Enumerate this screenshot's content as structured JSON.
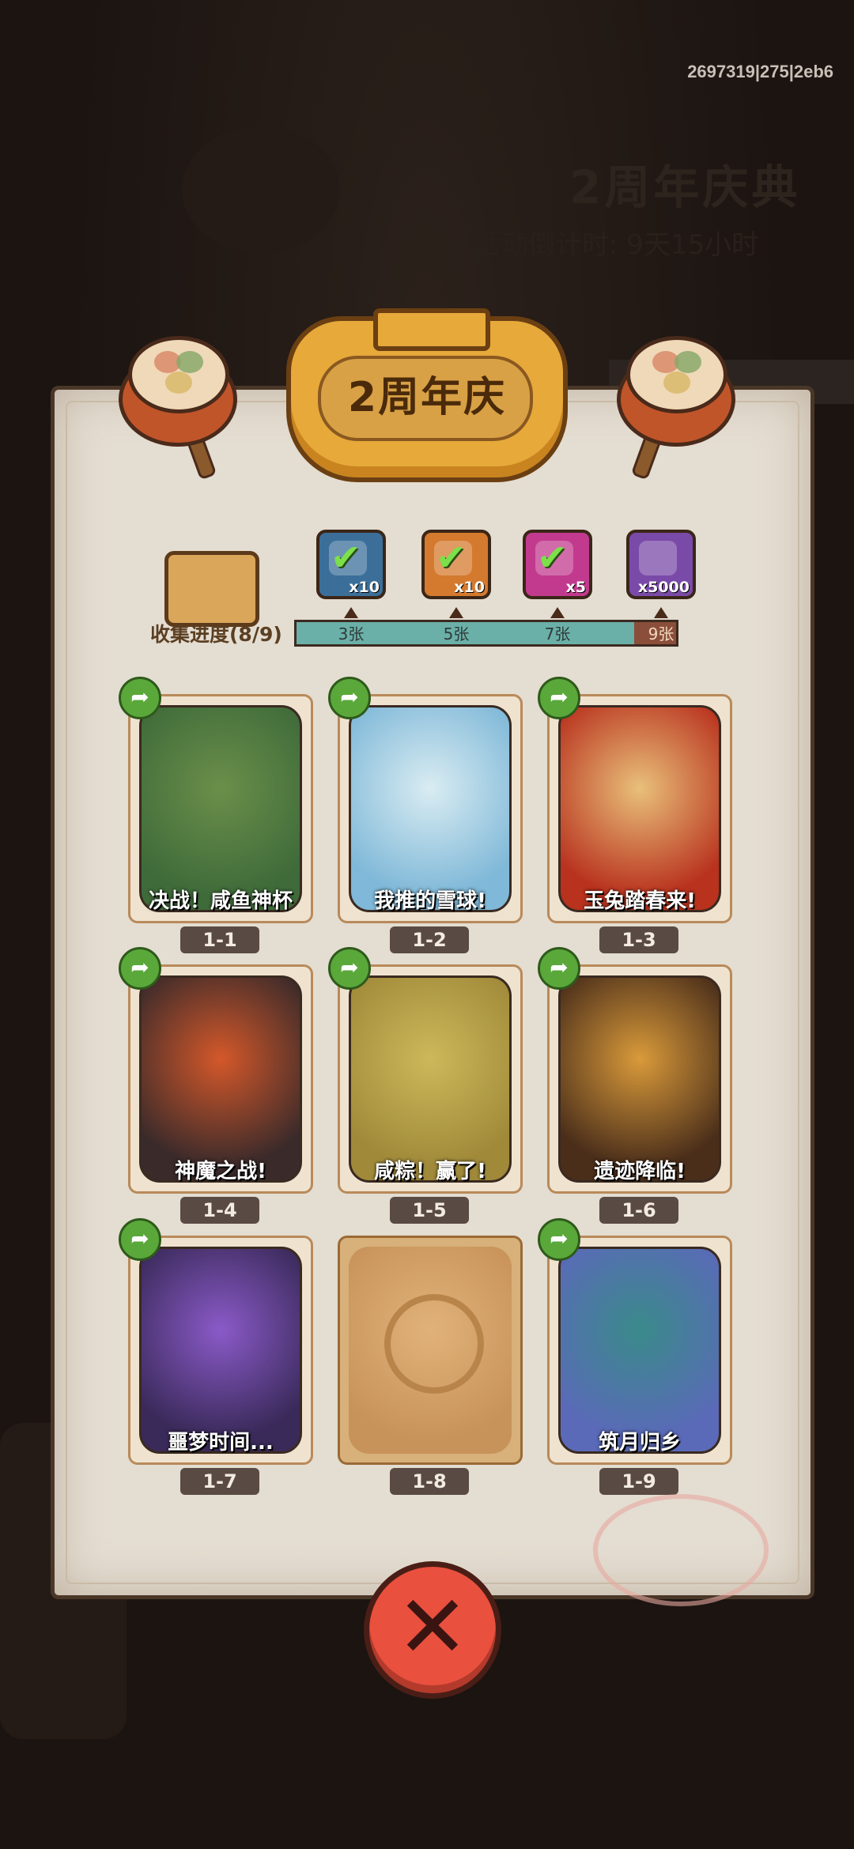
{
  "debug_id": "2697319|275|2eb6",
  "background": {
    "title": "2周年庆典",
    "subtitle": "活动倒计时: 9天15小时"
  },
  "panel": {
    "title": "2周年庆",
    "progress_label": "收集进度(8/9)",
    "progress": {
      "collected": 8,
      "total": 9
    },
    "milestones": [
      {
        "label": "3张",
        "reward_count": "x10",
        "color": "#3b6f9a",
        "icon": "chest-icon",
        "claimed": true
      },
      {
        "label": "5张",
        "reward_count": "x10",
        "color": "#d47a2e",
        "icon": "golden-gift-icon",
        "claimed": true
      },
      {
        "label": "7张",
        "reward_count": "x5",
        "color": "#c23a8e",
        "icon": "rainbow-orb-icon",
        "claimed": true
      },
      {
        "label": "9张",
        "reward_count": "x5000",
        "color": "#7a4aa8",
        "icon": "crystal-icon",
        "claimed": false
      }
    ],
    "cards": [
      {
        "id": "1-1",
        "caption": "决战！咸鱼神杯",
        "unlocked": true,
        "colors": [
          "#3f6b3a",
          "#6b8f4a"
        ]
      },
      {
        "id": "1-2",
        "caption": "我推的雪球!",
        "unlocked": true,
        "colors": [
          "#7fb8d8",
          "#d9ecf2"
        ]
      },
      {
        "id": "1-3",
        "caption": "玉兔踏春来!",
        "unlocked": true,
        "colors": [
          "#b8321e",
          "#e9c07a"
        ]
      },
      {
        "id": "1-4",
        "caption": "神魔之战!",
        "unlocked": true,
        "colors": [
          "#3a2a2a",
          "#d4582a"
        ]
      },
      {
        "id": "1-5",
        "caption": "咸粽！赢了!",
        "unlocked": true,
        "colors": [
          "#a08a3a",
          "#cdb85a"
        ]
      },
      {
        "id": "1-6",
        "caption": "遗迹降临!",
        "unlocked": true,
        "colors": [
          "#4a2e1a",
          "#d99a3a"
        ]
      },
      {
        "id": "1-7",
        "caption": "噩梦时间...",
        "unlocked": true,
        "colors": [
          "#3a2a5a",
          "#8a5ac8"
        ]
      },
      {
        "id": "1-8",
        "caption": "",
        "unlocked": false,
        "colors": [
          "#c8935a",
          "#e0b27a"
        ]
      },
      {
        "id": "1-9",
        "caption": "筑月归乡",
        "unlocked": true,
        "colors": [
          "#5a6ab8",
          "#3a8a8a"
        ]
      }
    ],
    "share_icon": "share-arrow-icon",
    "close_icon": "close-icon"
  }
}
